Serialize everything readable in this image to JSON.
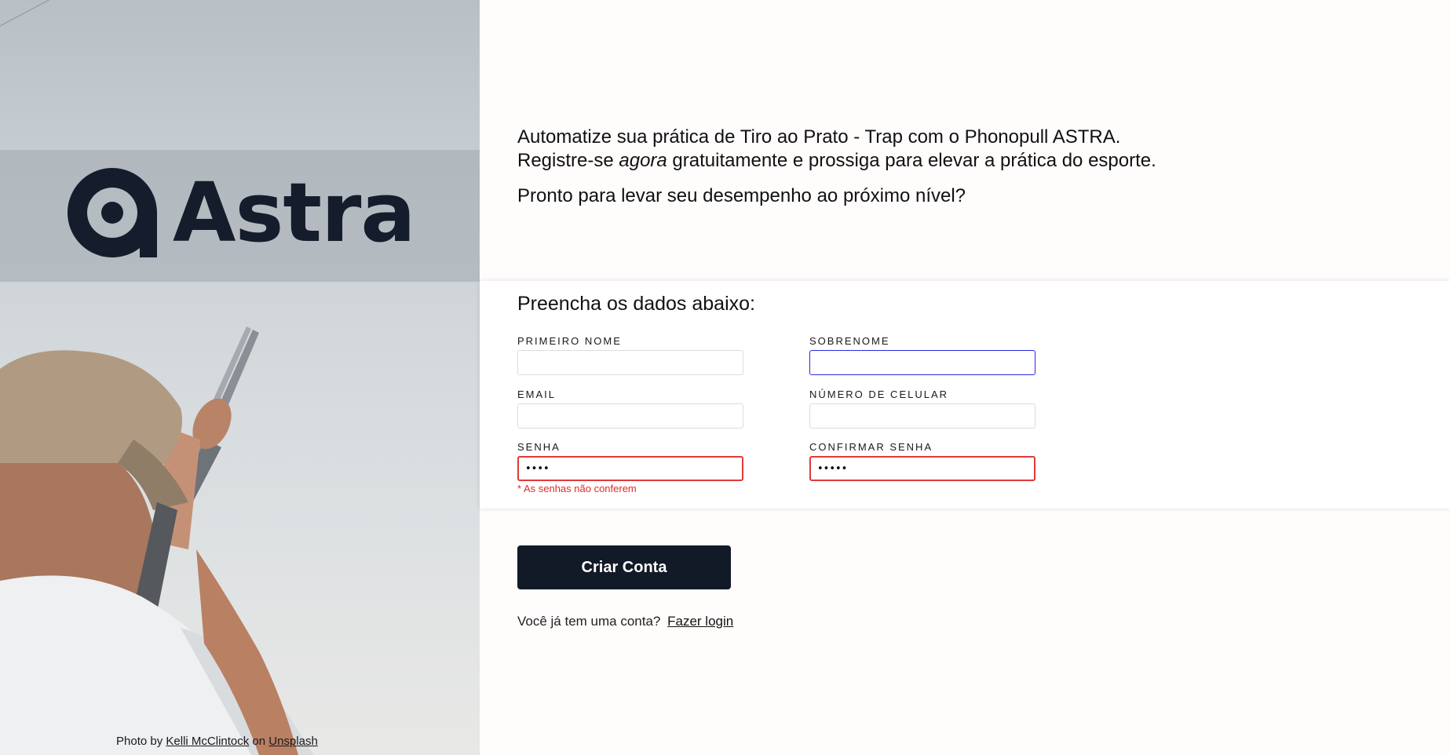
{
  "brand": {
    "name": "Astra",
    "logo_icon": "astra-logo-mark"
  },
  "intro": {
    "line1": "Automatize sua prática de Tiro ao Prato - Trap com o Phonopull ASTRA.",
    "line2_prefix": "Registre-se ",
    "line2_em": "agora",
    "line2_suffix": " gratuitamente e prossiga para elevar a prática do esporte.",
    "question": "Pronto para levar seu desempenho ao próximo nível?"
  },
  "form": {
    "title": "Preencha os dados abaixo:",
    "fields": {
      "first_name": {
        "label": "PRIMEIRO NOME",
        "value": ""
      },
      "last_name": {
        "label": "SOBRENOME",
        "value": ""
      },
      "email": {
        "label": "EMAIL",
        "value": ""
      },
      "phone": {
        "label": "NÚMERO DE CELULAR",
        "value": ""
      },
      "password": {
        "label": "SENHA",
        "value": "••••"
      },
      "confirm_password": {
        "label": "CONFIRMAR SENHA",
        "value": "•••••"
      }
    },
    "error": "* As senhas não conferem",
    "submit_label": "Criar Conta"
  },
  "login": {
    "prompt": "Você já tem uma conta?",
    "link": "Fazer login"
  },
  "credit": {
    "prefix": "Photo by",
    "author": "Kelli McClintock",
    "on": "on",
    "site": "Unsplash"
  },
  "colors": {
    "primary": "#131a27",
    "error": "#e03a3a",
    "focus": "#2a2ae0"
  }
}
